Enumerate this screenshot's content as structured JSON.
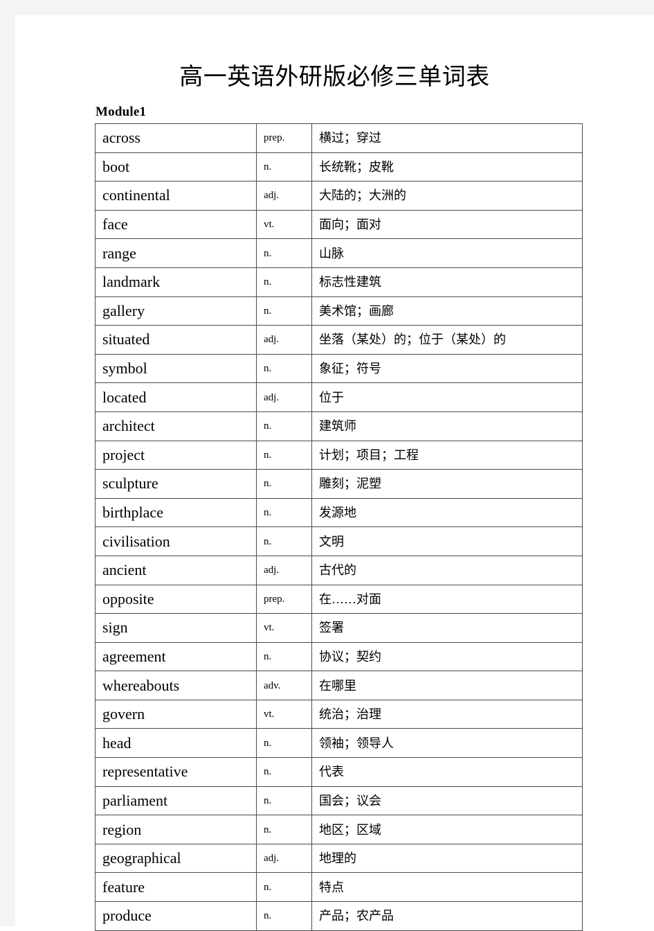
{
  "document": {
    "title": "高一英语外研版必修三单词表",
    "module_heading": "Module1"
  },
  "table": {
    "rows": [
      {
        "word": "across",
        "pos": "prep.",
        "definition": "横过；穿过"
      },
      {
        "word": "boot",
        "pos": "n.",
        "definition": "长统靴；皮靴"
      },
      {
        "word": "continental",
        "pos": "adj.",
        "definition": "大陆的；大洲的"
      },
      {
        "word": "face",
        "pos": "vt.",
        "definition": "面向；面对"
      },
      {
        "word": "range",
        "pos": "n.",
        "definition": "山脉"
      },
      {
        "word": "landmark",
        "pos": "n.",
        "definition": "标志性建筑"
      },
      {
        "word": "gallery",
        "pos": "n.",
        "definition": "美术馆；画廊"
      },
      {
        "word": "situated",
        "pos": "adj.",
        "definition": "坐落（某处）的；位于（某处）的"
      },
      {
        "word": "symbol",
        "pos": "n.",
        "definition": "象征；符号"
      },
      {
        "word": "located",
        "pos": "adj.",
        "definition": "位于"
      },
      {
        "word": "architect",
        "pos": "n.",
        "definition": "建筑师"
      },
      {
        "word": "project",
        "pos": "n.",
        "definition": "计划；项目；工程"
      },
      {
        "word": "sculpture",
        "pos": "n.",
        "definition": "雕刻；泥塑"
      },
      {
        "word": "birthplace",
        "pos": "n.",
        "definition": "发源地"
      },
      {
        "word": "civilisation",
        "pos": "n.",
        "definition": "文明"
      },
      {
        "word": "ancient",
        "pos": "adj.",
        "definition": "古代的"
      },
      {
        "word": "opposite",
        "pos": "prep.",
        "definition": "在……对面"
      },
      {
        "word": "sign",
        "pos": "vt.",
        "definition": "签署"
      },
      {
        "word": "agreement",
        "pos": "n.",
        "definition": "协议；契约"
      },
      {
        "word": "whereabouts",
        "pos": "adv.",
        "definition": "在哪里"
      },
      {
        "word": "govern",
        "pos": "vt.",
        "definition": "统治；治理"
      },
      {
        "word": "head",
        "pos": "n.",
        "definition": "领袖；领导人"
      },
      {
        "word": "representative",
        "pos": "n.",
        "definition": "代表"
      },
      {
        "word": "parliament",
        "pos": "n.",
        "definition": "国会；议会"
      },
      {
        "word": "region",
        "pos": "n.",
        "definition": "地区；区域"
      },
      {
        "word": "geographical",
        "pos": "adj.",
        "definition": "地理的"
      },
      {
        "word": "feature",
        "pos": "n.",
        "definition": "特点"
      },
      {
        "word": "produce",
        "pos": "n.",
        "definition": "产品；农产品"
      }
    ]
  }
}
